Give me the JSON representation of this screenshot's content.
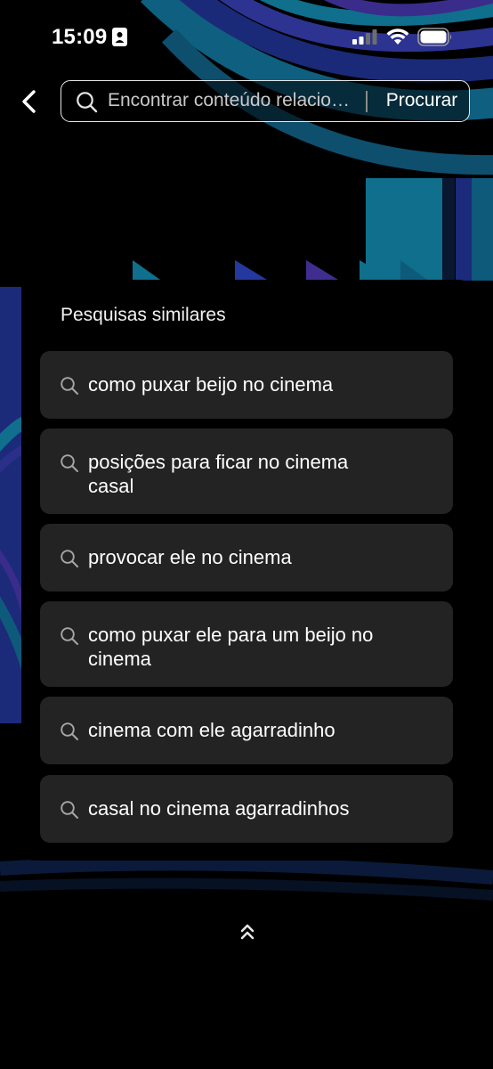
{
  "status_bar": {
    "time": "15:09"
  },
  "search": {
    "placeholder": "Encontrar conteúdo relacio…",
    "submit_label": "Procurar"
  },
  "similar": {
    "title": "Pesquisas similares",
    "items": [
      {
        "label": "como puxar beijo no cinema"
      },
      {
        "label": "posições para ficar no cinema casal"
      },
      {
        "label": "provocar ele no cinema"
      },
      {
        "label": "como puxar ele para um beijo no cinema"
      },
      {
        "label": "cinema com ele agarradinho"
      },
      {
        "label": "casal no cinema agarradinhos"
      }
    ]
  },
  "icons": {
    "back": "chevron-left-icon",
    "search": "search-icon",
    "collapse": "double-chevron-up-icon"
  },
  "colors": {
    "background": "#000000",
    "card": "#232323",
    "text": "#ffffff",
    "artwork_teal": "#0f6f8c",
    "artwork_navy": "#1c2a7a",
    "artwork_purple": "#3f2e8f"
  }
}
